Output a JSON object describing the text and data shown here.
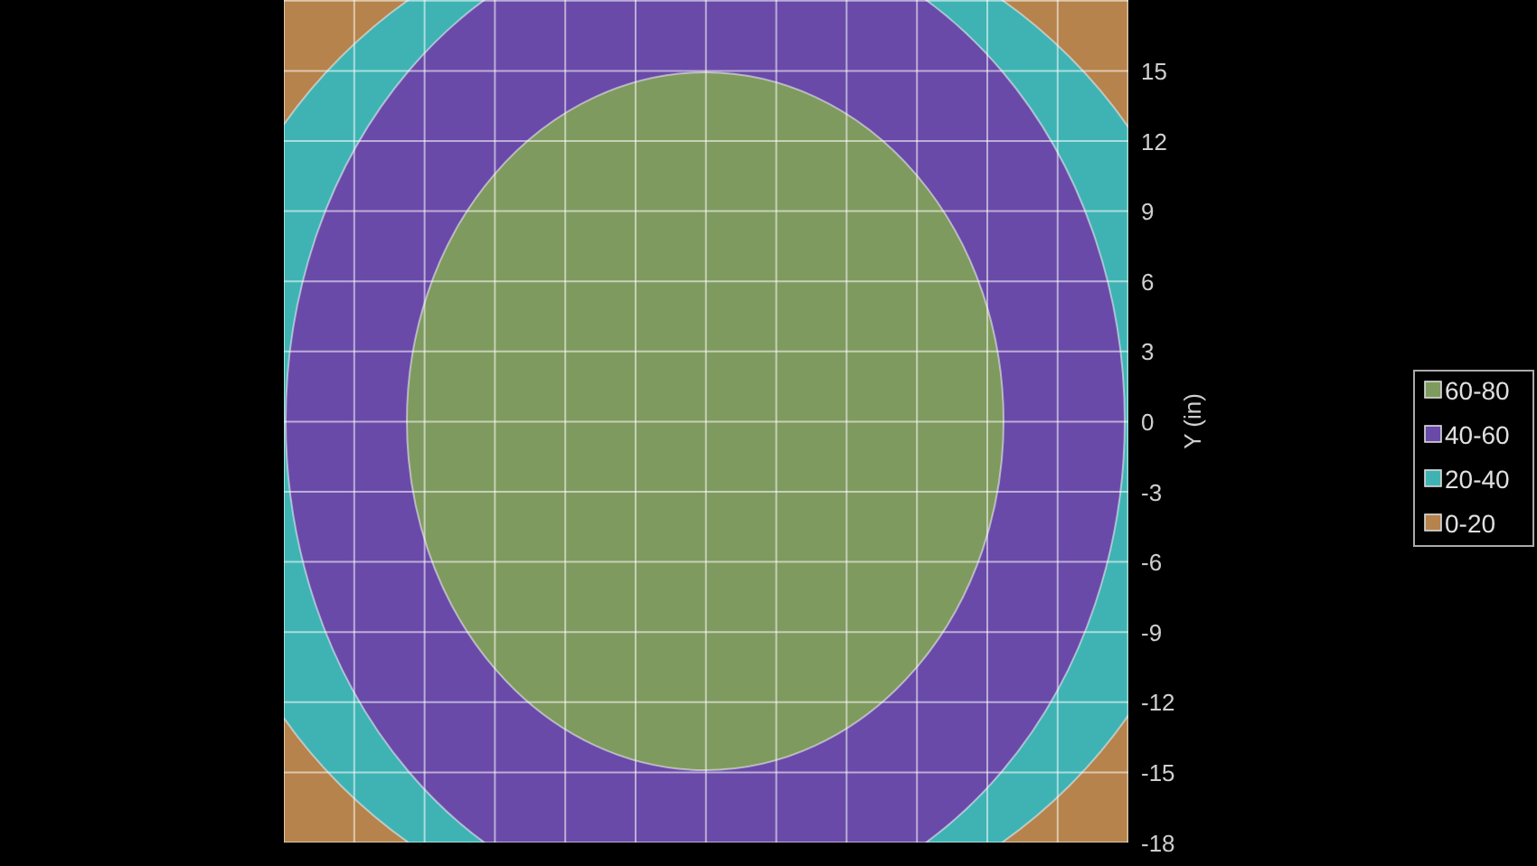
{
  "plot": {
    "y_axis": {
      "label": "Y (in)",
      "ticks": [
        "15",
        "12",
        "9",
        "6",
        "3",
        "0",
        "-3",
        "-6",
        "-9",
        "-12",
        "-15",
        "-18"
      ]
    },
    "legend": [
      {
        "label": "60-80",
        "color": "#7f9a5e"
      },
      {
        "label": "40-60",
        "color": "#6a4aa8"
      },
      {
        "label": "20-40",
        "color": "#3fb3b3"
      },
      {
        "label": "0-20",
        "color": "#b5834b"
      }
    ]
  }
}
